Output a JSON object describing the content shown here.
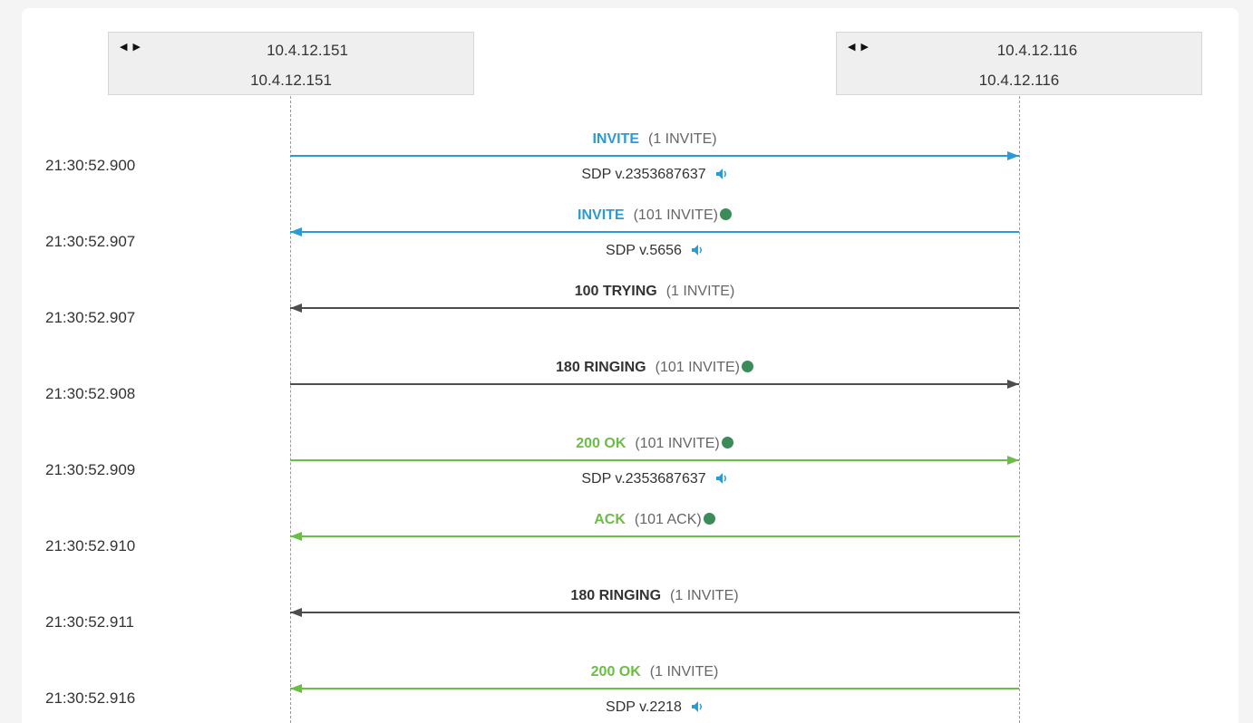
{
  "colors": {
    "invite": "#2a9bd6",
    "provisional": "#4d4d4d",
    "success": "#6bbd45",
    "dot": "#3c8c5a"
  },
  "hosts": {
    "left": {
      "nav_icons": "arrow-left-right-icons",
      "line1": "10.4.12.151",
      "line2": "10.4.12.151"
    },
    "right": {
      "nav_icons": "arrow-left-right-icons",
      "line1": "10.4.12.116",
      "line2": "10.4.12.116"
    }
  },
  "messages": [
    {
      "timestamp": "21:30:52.900",
      "method": "INVITE",
      "cseq": "(1 INVITE)",
      "direction": "right",
      "color": "invite",
      "dot": false,
      "sdp": "SDP v.2353687637"
    },
    {
      "timestamp": "21:30:52.907",
      "method": "INVITE",
      "cseq": "(101 INVITE)",
      "direction": "left",
      "color": "invite",
      "dot": true,
      "sdp": "SDP v.5656"
    },
    {
      "timestamp": "21:30:52.907",
      "method": "100 TRYING",
      "cseq": "(1 INVITE)",
      "direction": "left",
      "color": "provisional",
      "dot": false,
      "sdp": ""
    },
    {
      "timestamp": "21:30:52.908",
      "method": "180 RINGING",
      "cseq": "(101 INVITE)",
      "direction": "right",
      "color": "provisional",
      "dot": true,
      "sdp": ""
    },
    {
      "timestamp": "21:30:52.909",
      "method": "200 OK",
      "cseq": "(101 INVITE)",
      "direction": "right",
      "color": "success",
      "dot": true,
      "sdp": "SDP v.2353687637"
    },
    {
      "timestamp": "21:30:52.910",
      "method": "ACK",
      "cseq": "(101 ACK)",
      "direction": "left",
      "color": "success",
      "dot": true,
      "sdp": ""
    },
    {
      "timestamp": "21:30:52.911",
      "method": "180 RINGING",
      "cseq": "(1 INVITE)",
      "direction": "left",
      "color": "provisional",
      "dot": false,
      "sdp": ""
    },
    {
      "timestamp": "21:30:52.916",
      "method": "200 OK",
      "cseq": "(1 INVITE)",
      "direction": "left",
      "color": "success",
      "dot": false,
      "sdp": "SDP v.2218"
    }
  ]
}
